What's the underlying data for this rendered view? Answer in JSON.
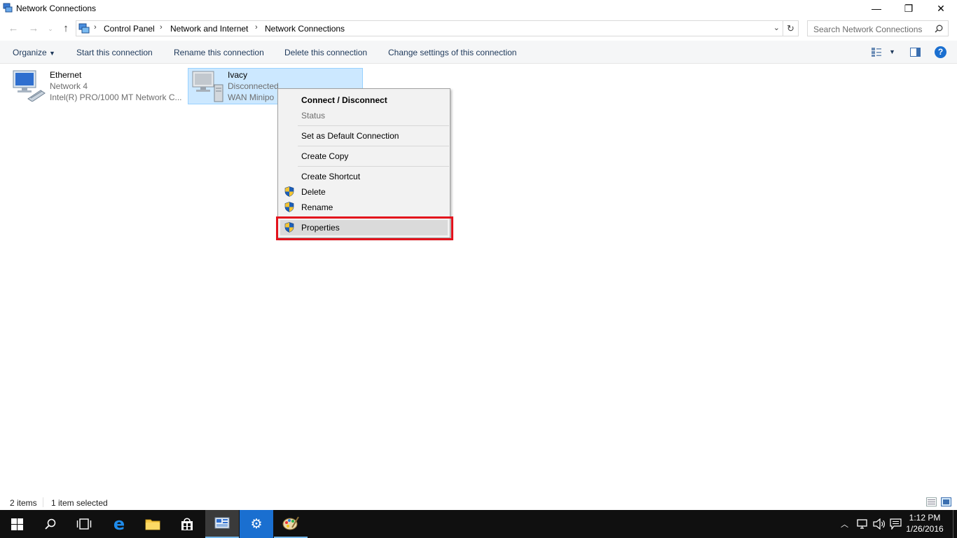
{
  "window": {
    "title": "Network Connections",
    "controls": {
      "minimize": "—",
      "restore": "❐",
      "close": "✕"
    }
  },
  "address": {
    "crumbs": [
      "Control Panel",
      "Network and Internet",
      "Network Connections"
    ],
    "search_placeholder": "Search Network Connections"
  },
  "commands": {
    "organize": "Organize",
    "start": "Start this connection",
    "rename": "Rename this connection",
    "delete": "Delete this connection",
    "change": "Change settings of this connection",
    "help": "?"
  },
  "connections": [
    {
      "name": "Ethernet",
      "status": "Network  4",
      "device": "Intel(R) PRO/1000 MT Network C..."
    },
    {
      "name": "Ivacy",
      "status": "Disconnected",
      "device": "WAN Minipo"
    }
  ],
  "context_menu": {
    "connect": "Connect / Disconnect",
    "status": "Status",
    "set_default": "Set as Default Connection",
    "create_copy": "Create Copy",
    "create_shortcut": "Create Shortcut",
    "delete": "Delete",
    "rename": "Rename",
    "properties": "Properties"
  },
  "statusbar": {
    "items": "2 items",
    "selected": "1 item selected"
  },
  "taskbar": {
    "time": "1:12 PM",
    "date": "1/26/2016"
  },
  "colors": {
    "selection": "#cce8ff",
    "highlight_box": "#e3121c",
    "taskbar": "#101010"
  }
}
